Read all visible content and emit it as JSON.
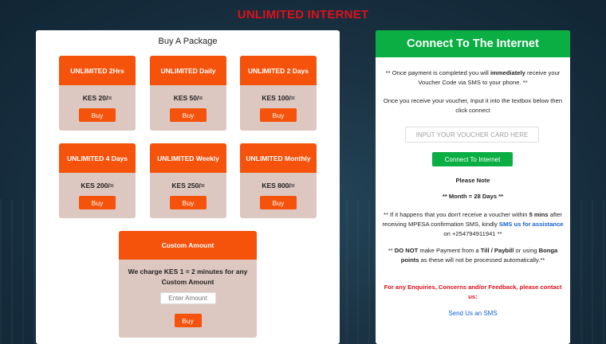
{
  "site_title": "UNLIMITED INTERNET",
  "left": {
    "heading": "Buy A Package",
    "packages": [
      {
        "name": "UNLIMITED 2Hrs",
        "price": "KES 20/=",
        "button": "Buy"
      },
      {
        "name": "UNLIMITED Daily",
        "price": "KES 50/=",
        "button": "Buy"
      },
      {
        "name": "UNLIMITED 2 Days",
        "price": "KES 100/=",
        "button": "Buy"
      },
      {
        "name": "UNLIMITED 4 Days",
        "price": "KES 200/=",
        "button": "Buy"
      },
      {
        "name": "UNLIMITED Weekly",
        "price": "KES 250/=",
        "button": "Buy"
      },
      {
        "name": "UNLIMITED Monthly",
        "price": "KES 800/=",
        "button": "Buy"
      }
    ],
    "custom": {
      "title": "Custom Amount",
      "description": "We charge KES 1 = 2 minutes for any Custom Amount",
      "input_placeholder": "Enter Amount",
      "button": "Buy"
    }
  },
  "right": {
    "title": "Connect To The Internet",
    "intro_pre": "** Once payment is completed you will ",
    "intro_bold": "immediately",
    "intro_post": " receive your Voucher Code via SMS to your phone. **",
    "instruction": "Once you receive your voucher, Input it into the textbox below then click connect",
    "voucher_placeholder": "INPUT YOUR VOUCHER CARD HERE",
    "connect_button": "Connect To Internet",
    "note_title": "Please Note",
    "month_note": "** Month = 28 Days **",
    "voucher_note_a": "** If it happens that you don't receive a voucher within ",
    "voucher_note_bold": "5 mins",
    "voucher_note_b": " after receiving MPESA confirmation SMS, kindly ",
    "voucher_note_link": "SMS us for assistance",
    "voucher_note_c": " on +254794911941 **",
    "payment_note_a": "** ",
    "payment_note_bold1": "DO NOT",
    "payment_note_b": " make Payment from a ",
    "payment_note_bold2": "Till / Paybill",
    "payment_note_c": " or using ",
    "payment_note_bold3": "Bonga points",
    "payment_note_d": " as these will not be processed automatically.**",
    "enquiries": "For any Enquiries, Concerns and/or Feedback, please contact us:",
    "sms_link": "Send Us an SMS"
  }
}
